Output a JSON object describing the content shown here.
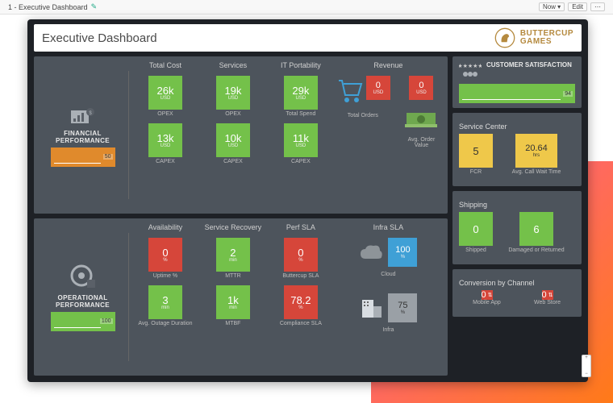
{
  "topbar": {
    "title": "1 - Executive Dashboard",
    "now_btn": "Now ▾",
    "edit_btn": "Edit"
  },
  "header": {
    "title": "Executive Dashboard",
    "brand_line1": "BUTTERCUP",
    "brand_line2": "GAMES"
  },
  "financial": {
    "category": "FINANCIAL PERFORMANCE",
    "spark_value": "50",
    "columns": {
      "total_cost": {
        "head": "Total Cost",
        "top": {
          "val": "26k",
          "unit": "USD",
          "cap": "OPEX"
        },
        "bot": {
          "val": "13k",
          "unit": "USD",
          "cap": "CAPEX"
        }
      },
      "services": {
        "head": "Services",
        "top": {
          "val": "19k",
          "unit": "USD",
          "cap": "OPEX"
        },
        "bot": {
          "val": "10k",
          "unit": "USD",
          "cap": "CAPEX"
        }
      },
      "itport": {
        "head": "IT Portability",
        "top": {
          "val": "29k",
          "unit": "USD",
          "cap": "Total Spend"
        },
        "bot": {
          "val": "11k",
          "unit": "USD",
          "cap": "CAPEX"
        }
      },
      "revenue": {
        "head": "Revenue",
        "orders": {
          "val": "0",
          "unit": "USD",
          "cap": "Total Orders"
        },
        "avg": {
          "val": "0",
          "unit": "USD",
          "cap": "Avg. Order Value"
        }
      }
    }
  },
  "operational": {
    "category": "OPERATIONAL PERFORMANCE",
    "spark_value": "100",
    "columns": {
      "availability": {
        "head": "Availability",
        "top": {
          "val": "0",
          "unit": "%",
          "cap": "Uptime %"
        },
        "bot": {
          "val": "3",
          "unit": "min",
          "cap": "Avg. Outage Duration"
        }
      },
      "recovery": {
        "head": "Service Recovery",
        "top": {
          "val": "2",
          "unit": "min",
          "cap": "MTTR"
        },
        "bot": {
          "val": "1k",
          "unit": "min",
          "cap": "MTBF"
        }
      },
      "perf_sla": {
        "head": "Perf SLA",
        "top": {
          "val": "0",
          "unit": "%",
          "cap": "Buttercup SLA"
        },
        "bot": {
          "val": "78.2",
          "unit": "%",
          "cap": "Compliance SLA"
        }
      },
      "infra_sla": {
        "head": "Infra SLA",
        "cloud": {
          "val": "100",
          "unit": "%",
          "cap": "Cloud"
        },
        "infra": {
          "val": "75",
          "unit": "%",
          "cap": "Infra"
        }
      }
    }
  },
  "right": {
    "csat": {
      "title": "CUSTOMER SATISFACTION",
      "value": "94"
    },
    "service_center": {
      "title": "Service Center",
      "fcr": {
        "val": "5",
        "cap": "FCR"
      },
      "wait": {
        "val": "20.64",
        "unit": "hrs",
        "cap": "Avg. Call Wait Time"
      }
    },
    "shipping": {
      "title": "Shipping",
      "shipped": {
        "val": "0",
        "cap": "Shipped"
      },
      "damaged": {
        "val": "6",
        "cap": "Damaged or Returned"
      }
    },
    "conversion": {
      "title": "Conversion by Channel",
      "mobile": {
        "val": "0",
        "cap": "Mobile App"
      },
      "web": {
        "val": "0",
        "cap": "Web Store"
      }
    }
  }
}
